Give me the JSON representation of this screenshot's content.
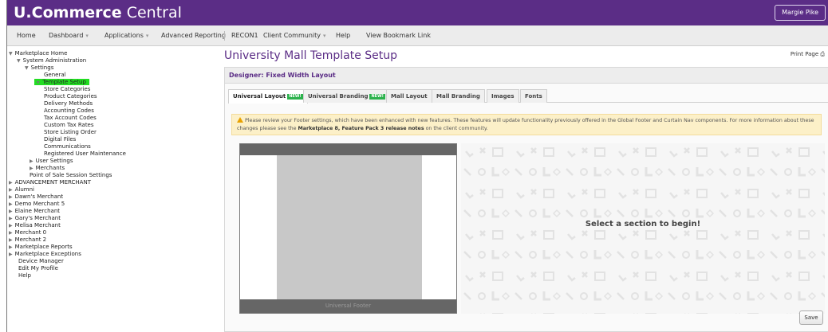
{
  "header": {
    "brand_bold": "U.Commerce",
    "brand_light": " Central",
    "user": "Margie Pike"
  },
  "nav": [
    {
      "label": "Home"
    },
    {
      "label": "Dashboard"
    },
    {
      "label": "Applications"
    },
    {
      "label": "Advanced Reporting"
    },
    {
      "label": "RECON1"
    },
    {
      "label": "Client Community"
    },
    {
      "label": "Help"
    },
    {
      "label": "View Bookmark Link"
    }
  ],
  "tree": [
    {
      "label": "Marketplace Home",
      "arrow": "▼"
    },
    {
      "label": "System Administration",
      "arrow": "▼"
    },
    {
      "label": "Settings",
      "arrow": "▼"
    },
    {
      "label": "General"
    },
    {
      "label": "Template Setup",
      "arrow": "★"
    },
    {
      "label": "Store Categories"
    },
    {
      "label": "Product Categories"
    },
    {
      "label": "Delivery Methods"
    },
    {
      "label": "Accounting Codes"
    },
    {
      "label": "Tax Account Codes"
    },
    {
      "label": "Custom Tax Rates"
    },
    {
      "label": "Store Listing Order"
    },
    {
      "label": "Digital Files"
    },
    {
      "label": "Communications"
    },
    {
      "label": "Registered User Maintenance"
    },
    {
      "label": "User Settings",
      "arrow": "▶"
    },
    {
      "label": "Merchants",
      "arrow": "▶"
    },
    {
      "label": "Point of Sale Session Settings"
    },
    {
      "label": "ADVANCEMENT MERCHANT",
      "arrow": "▶"
    },
    {
      "label": "Alumni",
      "arrow": "▶"
    },
    {
      "label": "Dawn's Merchant",
      "arrow": "▶"
    },
    {
      "label": "Demo Merchant 5",
      "arrow": "▶"
    },
    {
      "label": "Elaine Merchant",
      "arrow": "▶"
    },
    {
      "label": "Gary's Merchant",
      "arrow": "▶"
    },
    {
      "label": "Melisa Merchant",
      "arrow": "▶"
    },
    {
      "label": "Merchant 0",
      "arrow": "▶"
    },
    {
      "label": "Merchant 2",
      "arrow": "▶"
    },
    {
      "label": "Marketplace Reports",
      "arrow": "▶"
    },
    {
      "label": "Marketplace Exceptions",
      "arrow": "▶"
    },
    {
      "label": "Device Manager"
    },
    {
      "label": "Edit My Profile"
    },
    {
      "label": "Help"
    }
  ],
  "main": {
    "title": "University Mall Template Setup",
    "print": "Print Page",
    "panel_title": "Designer: Fixed Width Layout",
    "tabs": [
      {
        "label": "Universal Layout",
        "badge": "NEW!"
      },
      {
        "label": "Universal Branding",
        "badge": "NEW!"
      },
      {
        "label": "Mall Layout"
      },
      {
        "label": "Mall Branding"
      },
      {
        "label": "Images"
      },
      {
        "label": "Fonts"
      }
    ],
    "notice": {
      "text1": "Please review your Footer settings, which have been enhanced with new features. These features will update functionality previously offered in the Global Footer and Curtain Nav components. For more information about these changes please see the ",
      "link": "Marketplace 8, Feature Pack 3 release notes",
      "text2": " on the client community."
    },
    "preview_footer": "Universal Footer",
    "canvas_message": "Select a section to begin!",
    "save": "Save"
  },
  "colors": {
    "brand": "#5b2d86",
    "selected": "#22dd22",
    "badge": "#2bb24c"
  }
}
